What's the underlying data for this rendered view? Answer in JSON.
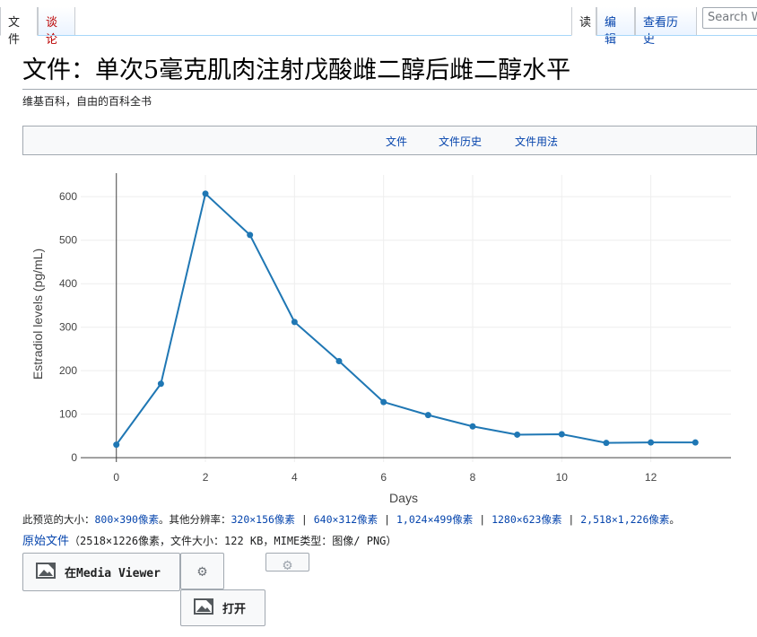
{
  "tabs": {
    "file": "文件",
    "discussion": "谈论",
    "read": "读",
    "edit": "编辑",
    "history": "查看历史"
  },
  "search": {
    "placeholder": "Search Wikipedia"
  },
  "page_title": "文件：单次5毫克肌肉注射戊酸雌二醇后雌二醇水平",
  "tagline": "维基百科，自由的百科全书",
  "file_toc": [
    "文件",
    "文件历史",
    "文件用法"
  ],
  "chart_data": {
    "type": "line",
    "x": [
      0,
      1,
      2,
      3,
      4,
      5,
      6,
      7,
      8,
      9,
      10,
      11,
      12,
      13
    ],
    "series": [
      {
        "values": [
          30,
          170,
          607,
          512,
          312,
          222,
          128,
          98,
          72,
          53,
          54,
          34,
          35,
          35
        ]
      }
    ],
    "xlabel": "Days",
    "ylabel": "Estradiol levels (pg/mL)",
    "xlim": [
      -0.8,
      13.8
    ],
    "ylim": [
      -10,
      650
    ],
    "xticks": [
      0,
      2,
      4,
      6,
      8,
      10,
      12
    ],
    "yticks": [
      0,
      100,
      200,
      300,
      400,
      500,
      600
    ],
    "grid": true,
    "color": "#1f77b4"
  },
  "file_info": {
    "preview_prefix": "此预览的大小：",
    "preview_size": "800×390像素",
    "other_res_prefix": "。其他分辨率：",
    "resolutions": [
      "320×156像素",
      "640×312像素",
      "1,024×499像素",
      "1280×623像素",
      "2,518×1,226像素"
    ],
    "separator": " | ",
    "suffix": "。"
  },
  "original": {
    "link": "原始文件",
    "details": "（2518×1226像素，文件大小：122 KB，MIME类型：图像/ PNG）"
  },
  "buttons": {
    "media_viewer": "在Media Viewer",
    "open": "打开"
  },
  "colors": {
    "link": "#0645ad",
    "new_link": "#ba0000",
    "line": "#1f77b4"
  }
}
